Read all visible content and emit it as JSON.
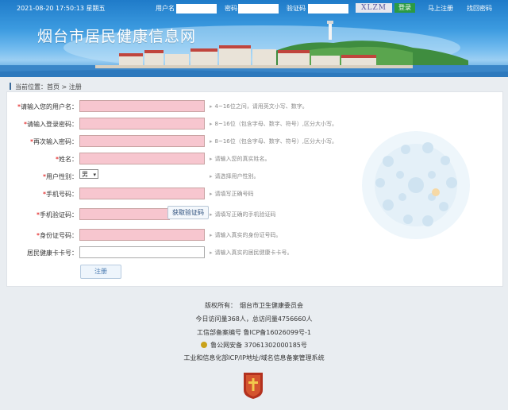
{
  "topbar": {
    "datetime": "2021-08-20 17:50:13 星期五",
    "username_label": "用户名",
    "password_label": "密码",
    "captcha_label": "验证码",
    "captcha_text": "XLZM",
    "login_label": "登录",
    "register_label": "马上注册",
    "recover_label": "找回密码"
  },
  "header": {
    "title": "烟台市居民健康信息网"
  },
  "breadcrumb": {
    "prefix": "当前位置：",
    "home": "首页",
    "sep": " > ",
    "current": "注册"
  },
  "form": {
    "fields": [
      {
        "label": "请输入您的用户名：",
        "required": true,
        "hint": "4~16位之间，请用英文小写、数字。"
      },
      {
        "label": "请输入登录密码：",
        "required": true,
        "hint": "8~16位（包含字母、数字、符号）,区分大小写。"
      },
      {
        "label": "再次输入密码：",
        "required": true,
        "hint": "8~16位（包含字母、数字、符号）,区分大小写。"
      },
      {
        "label": "姓名：",
        "required": true,
        "hint": "请输入您的真实姓名。"
      },
      {
        "label": "用户性别：",
        "required": true,
        "hint": "请选择用户性别。",
        "value": "男"
      },
      {
        "label": "手机号码：",
        "required": true,
        "hint": "请填写正确号码"
      },
      {
        "label": "手机验证码：",
        "required": true,
        "hint": "请填写正确的手机验证码",
        "button": "获取验证码"
      },
      {
        "label": "身份证号码：",
        "required": true,
        "hint": "请输入真实的身份证号码。"
      },
      {
        "label": "居民健康卡卡号：",
        "required": false,
        "hint": "请输入真实的居民健康卡卡号。"
      }
    ],
    "submit_label": "注册"
  },
  "footer": {
    "copyright": "版权所有：　烟台市卫生健康委员会",
    "visits": "今日访问量368人，总访问量4756660人",
    "icp": "工信部备案编号 鲁ICP备16026099号-1",
    "police": "鲁公网安备 37061302000185号",
    "miit": "工业和信息化部ICP/IP地址/域名信息备案管理系统"
  },
  "colors": {
    "header_blue": "#2d88cf",
    "required_field": "#f7c6cf",
    "login_green": "#2b9a43"
  }
}
